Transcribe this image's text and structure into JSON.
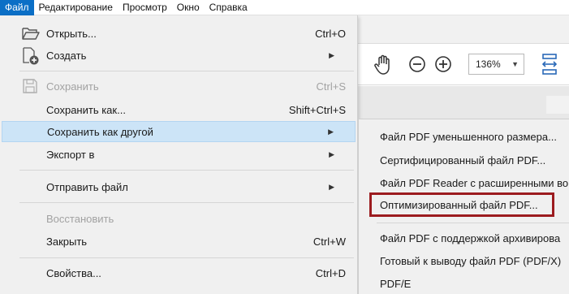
{
  "menubar": {
    "items": [
      {
        "label": "Файл",
        "active": true
      },
      {
        "label": "Редактирование"
      },
      {
        "label": "Просмотр"
      },
      {
        "label": "Окно"
      },
      {
        "label": "Справка"
      }
    ]
  },
  "toolbar": {
    "zoom_value": "136%",
    "icons": [
      "hand-icon",
      "zoom-out-icon",
      "zoom-in-icon",
      "fit-width-icon"
    ]
  },
  "file_menu": {
    "items": [
      {
        "label": "Открыть...",
        "shortcut": "Ctrl+O",
        "icon": "folder-open-icon"
      },
      {
        "label": "Создать",
        "submenu": true,
        "icon": "new-document-icon"
      },
      {
        "label": "Сохранить",
        "shortcut": "Ctrl+S",
        "disabled": true,
        "icon": "save-icon"
      },
      {
        "label": "Сохранить как...",
        "shortcut": "Shift+Ctrl+S"
      },
      {
        "label": "Сохранить как другой",
        "submenu": true,
        "highlighted": true
      },
      {
        "label": "Экспорт в",
        "submenu": true
      },
      {
        "label": "Отправить файл",
        "submenu": true
      },
      {
        "label": "Восстановить",
        "disabled": true
      },
      {
        "label": "Закрыть",
        "shortcut": "Ctrl+W"
      },
      {
        "label": "Свойства...",
        "shortcut": "Ctrl+D"
      }
    ]
  },
  "submenu": {
    "items": [
      {
        "label": "Файл PDF уменьшенного размера..."
      },
      {
        "label": "Сертифицированный файл PDF..."
      },
      {
        "label": "Файл PDF Reader с расширенными во"
      },
      {
        "label": "Оптимизированный файл PDF...",
        "boxed": true
      },
      {
        "label": "Файл PDF с поддержкой архивирова"
      },
      {
        "label": "Готовый к выводу файл PDF (PDF/X)"
      },
      {
        "label": "PDF/E"
      }
    ]
  },
  "colors": {
    "active_menu": "#0b6fc6",
    "highlight": "#cce4f7",
    "annotation_box": "#9c1b1f",
    "toolbar_icon": "#2a69b8"
  }
}
